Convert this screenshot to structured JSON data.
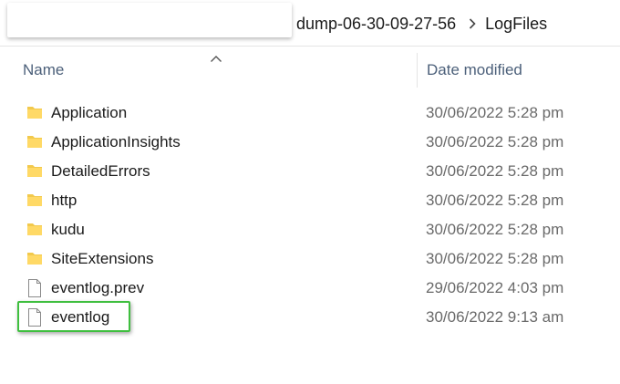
{
  "breadcrumb": {
    "items": [
      "dump-06-30-09-27-56",
      "LogFiles"
    ],
    "separator_icon": "chevron-right-icon"
  },
  "columns": {
    "name": "Name",
    "date_modified": "Date modified",
    "sort_icon": "chevron-up-icon"
  },
  "files": [
    {
      "name": "Application",
      "date": "30/06/2022 5:28 pm",
      "type": "folder"
    },
    {
      "name": "ApplicationInsights",
      "date": "30/06/2022 5:28 pm",
      "type": "folder"
    },
    {
      "name": "DetailedErrors",
      "date": "30/06/2022 5:28 pm",
      "type": "folder"
    },
    {
      "name": "http",
      "date": "30/06/2022 5:28 pm",
      "type": "folder"
    },
    {
      "name": "kudu",
      "date": "30/06/2022 5:28 pm",
      "type": "folder"
    },
    {
      "name": "SiteExtensions",
      "date": "30/06/2022 5:28 pm",
      "type": "folder"
    },
    {
      "name": "eventlog.prev",
      "date": "29/06/2022 4:03 pm",
      "type": "file"
    },
    {
      "name": "eventlog",
      "date": "30/06/2022 9:13 am",
      "type": "file"
    }
  ],
  "colors": {
    "highlight": "#3fbf3f",
    "folder": "#f2c94c",
    "header_text": "#4c607a"
  }
}
